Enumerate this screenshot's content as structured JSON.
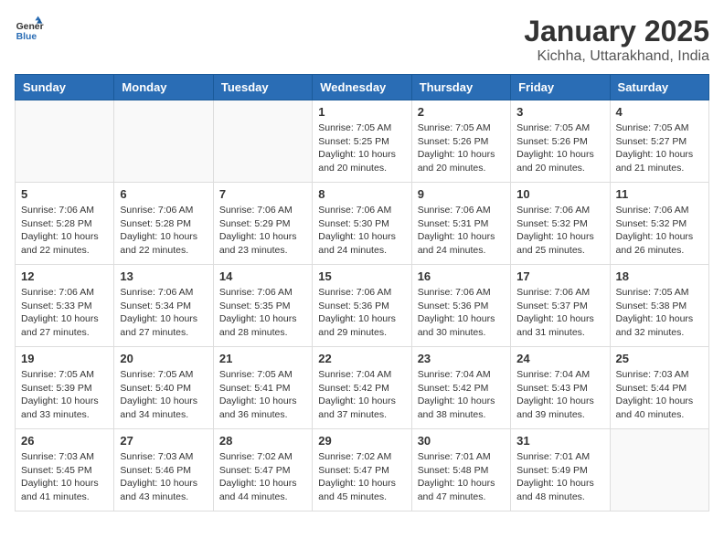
{
  "logo": {
    "line1": "General",
    "line2": "Blue"
  },
  "title": "January 2025",
  "subtitle": "Kichha, Uttarakhand, India",
  "days_of_week": [
    "Sunday",
    "Monday",
    "Tuesday",
    "Wednesday",
    "Thursday",
    "Friday",
    "Saturday"
  ],
  "weeks": [
    [
      {
        "num": "",
        "sunrise": "",
        "sunset": "",
        "daylight": ""
      },
      {
        "num": "",
        "sunrise": "",
        "sunset": "",
        "daylight": ""
      },
      {
        "num": "",
        "sunrise": "",
        "sunset": "",
        "daylight": ""
      },
      {
        "num": "1",
        "sunrise": "Sunrise: 7:05 AM",
        "sunset": "Sunset: 5:25 PM",
        "daylight": "Daylight: 10 hours and 20 minutes."
      },
      {
        "num": "2",
        "sunrise": "Sunrise: 7:05 AM",
        "sunset": "Sunset: 5:26 PM",
        "daylight": "Daylight: 10 hours and 20 minutes."
      },
      {
        "num": "3",
        "sunrise": "Sunrise: 7:05 AM",
        "sunset": "Sunset: 5:26 PM",
        "daylight": "Daylight: 10 hours and 20 minutes."
      },
      {
        "num": "4",
        "sunrise": "Sunrise: 7:05 AM",
        "sunset": "Sunset: 5:27 PM",
        "daylight": "Daylight: 10 hours and 21 minutes."
      }
    ],
    [
      {
        "num": "5",
        "sunrise": "Sunrise: 7:06 AM",
        "sunset": "Sunset: 5:28 PM",
        "daylight": "Daylight: 10 hours and 22 minutes."
      },
      {
        "num": "6",
        "sunrise": "Sunrise: 7:06 AM",
        "sunset": "Sunset: 5:28 PM",
        "daylight": "Daylight: 10 hours and 22 minutes."
      },
      {
        "num": "7",
        "sunrise": "Sunrise: 7:06 AM",
        "sunset": "Sunset: 5:29 PM",
        "daylight": "Daylight: 10 hours and 23 minutes."
      },
      {
        "num": "8",
        "sunrise": "Sunrise: 7:06 AM",
        "sunset": "Sunset: 5:30 PM",
        "daylight": "Daylight: 10 hours and 24 minutes."
      },
      {
        "num": "9",
        "sunrise": "Sunrise: 7:06 AM",
        "sunset": "Sunset: 5:31 PM",
        "daylight": "Daylight: 10 hours and 24 minutes."
      },
      {
        "num": "10",
        "sunrise": "Sunrise: 7:06 AM",
        "sunset": "Sunset: 5:32 PM",
        "daylight": "Daylight: 10 hours and 25 minutes."
      },
      {
        "num": "11",
        "sunrise": "Sunrise: 7:06 AM",
        "sunset": "Sunset: 5:32 PM",
        "daylight": "Daylight: 10 hours and 26 minutes."
      }
    ],
    [
      {
        "num": "12",
        "sunrise": "Sunrise: 7:06 AM",
        "sunset": "Sunset: 5:33 PM",
        "daylight": "Daylight: 10 hours and 27 minutes."
      },
      {
        "num": "13",
        "sunrise": "Sunrise: 7:06 AM",
        "sunset": "Sunset: 5:34 PM",
        "daylight": "Daylight: 10 hours and 27 minutes."
      },
      {
        "num": "14",
        "sunrise": "Sunrise: 7:06 AM",
        "sunset": "Sunset: 5:35 PM",
        "daylight": "Daylight: 10 hours and 28 minutes."
      },
      {
        "num": "15",
        "sunrise": "Sunrise: 7:06 AM",
        "sunset": "Sunset: 5:36 PM",
        "daylight": "Daylight: 10 hours and 29 minutes."
      },
      {
        "num": "16",
        "sunrise": "Sunrise: 7:06 AM",
        "sunset": "Sunset: 5:36 PM",
        "daylight": "Daylight: 10 hours and 30 minutes."
      },
      {
        "num": "17",
        "sunrise": "Sunrise: 7:06 AM",
        "sunset": "Sunset: 5:37 PM",
        "daylight": "Daylight: 10 hours and 31 minutes."
      },
      {
        "num": "18",
        "sunrise": "Sunrise: 7:05 AM",
        "sunset": "Sunset: 5:38 PM",
        "daylight": "Daylight: 10 hours and 32 minutes."
      }
    ],
    [
      {
        "num": "19",
        "sunrise": "Sunrise: 7:05 AM",
        "sunset": "Sunset: 5:39 PM",
        "daylight": "Daylight: 10 hours and 33 minutes."
      },
      {
        "num": "20",
        "sunrise": "Sunrise: 7:05 AM",
        "sunset": "Sunset: 5:40 PM",
        "daylight": "Daylight: 10 hours and 34 minutes."
      },
      {
        "num": "21",
        "sunrise": "Sunrise: 7:05 AM",
        "sunset": "Sunset: 5:41 PM",
        "daylight": "Daylight: 10 hours and 36 minutes."
      },
      {
        "num": "22",
        "sunrise": "Sunrise: 7:04 AM",
        "sunset": "Sunset: 5:42 PM",
        "daylight": "Daylight: 10 hours and 37 minutes."
      },
      {
        "num": "23",
        "sunrise": "Sunrise: 7:04 AM",
        "sunset": "Sunset: 5:42 PM",
        "daylight": "Daylight: 10 hours and 38 minutes."
      },
      {
        "num": "24",
        "sunrise": "Sunrise: 7:04 AM",
        "sunset": "Sunset: 5:43 PM",
        "daylight": "Daylight: 10 hours and 39 minutes."
      },
      {
        "num": "25",
        "sunrise": "Sunrise: 7:03 AM",
        "sunset": "Sunset: 5:44 PM",
        "daylight": "Daylight: 10 hours and 40 minutes."
      }
    ],
    [
      {
        "num": "26",
        "sunrise": "Sunrise: 7:03 AM",
        "sunset": "Sunset: 5:45 PM",
        "daylight": "Daylight: 10 hours and 41 minutes."
      },
      {
        "num": "27",
        "sunrise": "Sunrise: 7:03 AM",
        "sunset": "Sunset: 5:46 PM",
        "daylight": "Daylight: 10 hours and 43 minutes."
      },
      {
        "num": "28",
        "sunrise": "Sunrise: 7:02 AM",
        "sunset": "Sunset: 5:47 PM",
        "daylight": "Daylight: 10 hours and 44 minutes."
      },
      {
        "num": "29",
        "sunrise": "Sunrise: 7:02 AM",
        "sunset": "Sunset: 5:47 PM",
        "daylight": "Daylight: 10 hours and 45 minutes."
      },
      {
        "num": "30",
        "sunrise": "Sunrise: 7:01 AM",
        "sunset": "Sunset: 5:48 PM",
        "daylight": "Daylight: 10 hours and 47 minutes."
      },
      {
        "num": "31",
        "sunrise": "Sunrise: 7:01 AM",
        "sunset": "Sunset: 5:49 PM",
        "daylight": "Daylight: 10 hours and 48 minutes."
      },
      {
        "num": "",
        "sunrise": "",
        "sunset": "",
        "daylight": ""
      }
    ]
  ]
}
